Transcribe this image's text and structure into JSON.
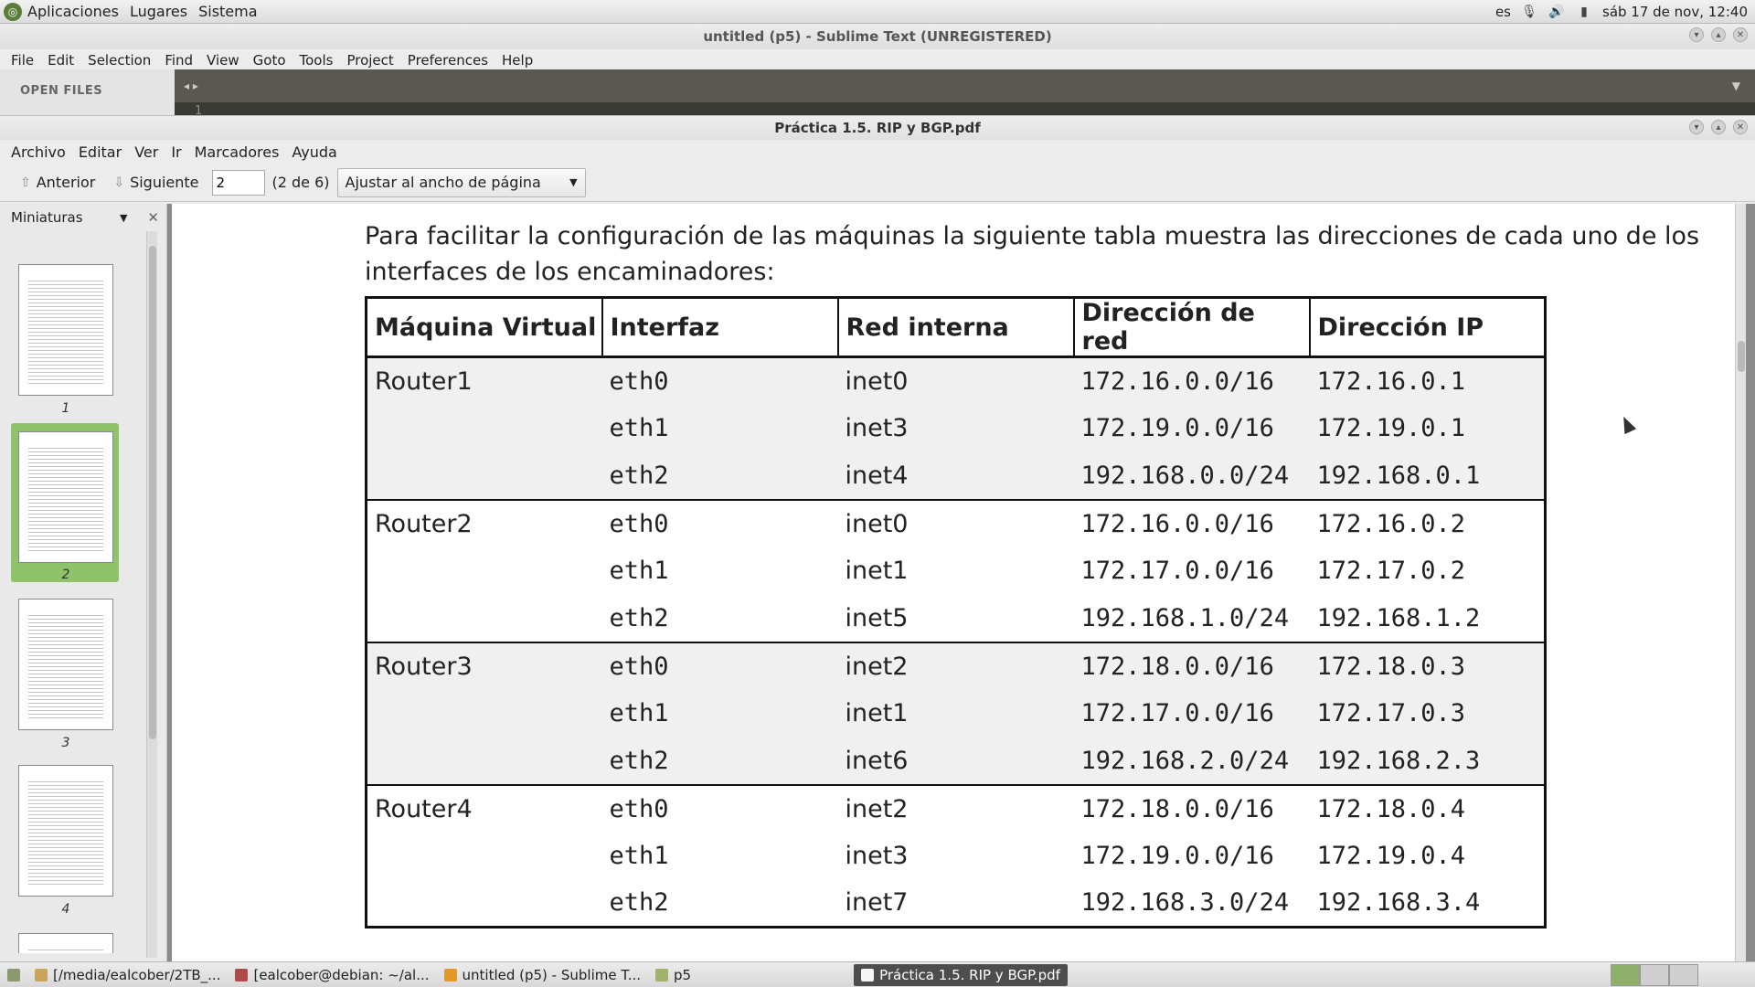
{
  "top_panel": {
    "menus": [
      "Aplicaciones",
      "Lugares",
      "Sistema"
    ],
    "keyboard_layout": "es",
    "datetime": "sáb 17 de nov, 12:40"
  },
  "sublime": {
    "title": "untitled (p5) - Sublime Text (UNREGISTERED)",
    "menus": [
      "File",
      "Edit",
      "Selection",
      "Find",
      "View",
      "Goto",
      "Tools",
      "Project",
      "Preferences",
      "Help"
    ],
    "sidebar_label": "OPEN FILES",
    "line_number": "1"
  },
  "evince": {
    "title": "Práctica 1.5. RIP y BGP.pdf",
    "menus": [
      "Archivo",
      "Editar",
      "Ver",
      "Ir",
      "Marcadores",
      "Ayuda"
    ],
    "toolbar": {
      "prev_label": "Anterior",
      "next_label": "Siguiente",
      "page_value": "2",
      "page_count": "(2 de 6)",
      "zoom_value": "Ajustar al ancho de página"
    },
    "sidebar": {
      "title": "Miniaturas",
      "pages": [
        "1",
        "2",
        "3",
        "4"
      ],
      "selected_page": "2"
    },
    "document": {
      "intro": "Para facilitar la configuración de las máquinas la siguiente tabla muestra las direcciones de cada uno de los interfaces de los encaminadores:",
      "table": {
        "headers": [
          "Máquina Virtual",
          "Interfaz",
          "Red interna",
          "Dirección de red",
          "Dirección IP"
        ],
        "rows": [
          [
            "Router1",
            "eth0",
            "inet0",
            "172.16.0.0/16",
            "172.16.0.1"
          ],
          [
            "",
            "eth1",
            "inet3",
            "172.19.0.0/16",
            "172.19.0.1"
          ],
          [
            "",
            "eth2",
            "inet4",
            "192.168.0.0/24",
            "192.168.0.1"
          ],
          [
            "Router2",
            "eth0",
            "inet0",
            "172.16.0.0/16",
            "172.16.0.2"
          ],
          [
            "",
            "eth1",
            "inet1",
            "172.17.0.0/16",
            "172.17.0.2"
          ],
          [
            "",
            "eth2",
            "inet5",
            "192.168.1.0/24",
            "192.168.1.2"
          ],
          [
            "Router3",
            "eth0",
            "inet2",
            "172.18.0.0/16",
            "172.18.0.3"
          ],
          [
            "",
            "eth1",
            "inet1",
            "172.17.0.0/16",
            "172.17.0.3"
          ],
          [
            "",
            "eth2",
            "inet6",
            "192.168.2.0/24",
            "192.168.2.3"
          ],
          [
            "Router4",
            "eth0",
            "inet2",
            "172.18.0.0/16",
            "172.18.0.4"
          ],
          [
            "",
            "eth1",
            "inet3",
            "172.19.0.0/16",
            "172.19.0.4"
          ],
          [
            "",
            "eth2",
            "inet7",
            "192.168.3.0/24",
            "192.168.3.4"
          ]
        ]
      }
    }
  },
  "taskbar": {
    "tasks": [
      "[/media/ealcober/2TB_...",
      "[ealcober@debian: ~/al...",
      "untitled (p5) - Sublime T...",
      "p5",
      "Práctica 1.5. RIP y BGP.pdf"
    ],
    "active_task": "Práctica 1.5. RIP y BGP.pdf"
  },
  "colors": {
    "selection_green": "#8fc36a",
    "editor_bg": "#3a3b35",
    "table_shade": "#f0f0f0"
  }
}
